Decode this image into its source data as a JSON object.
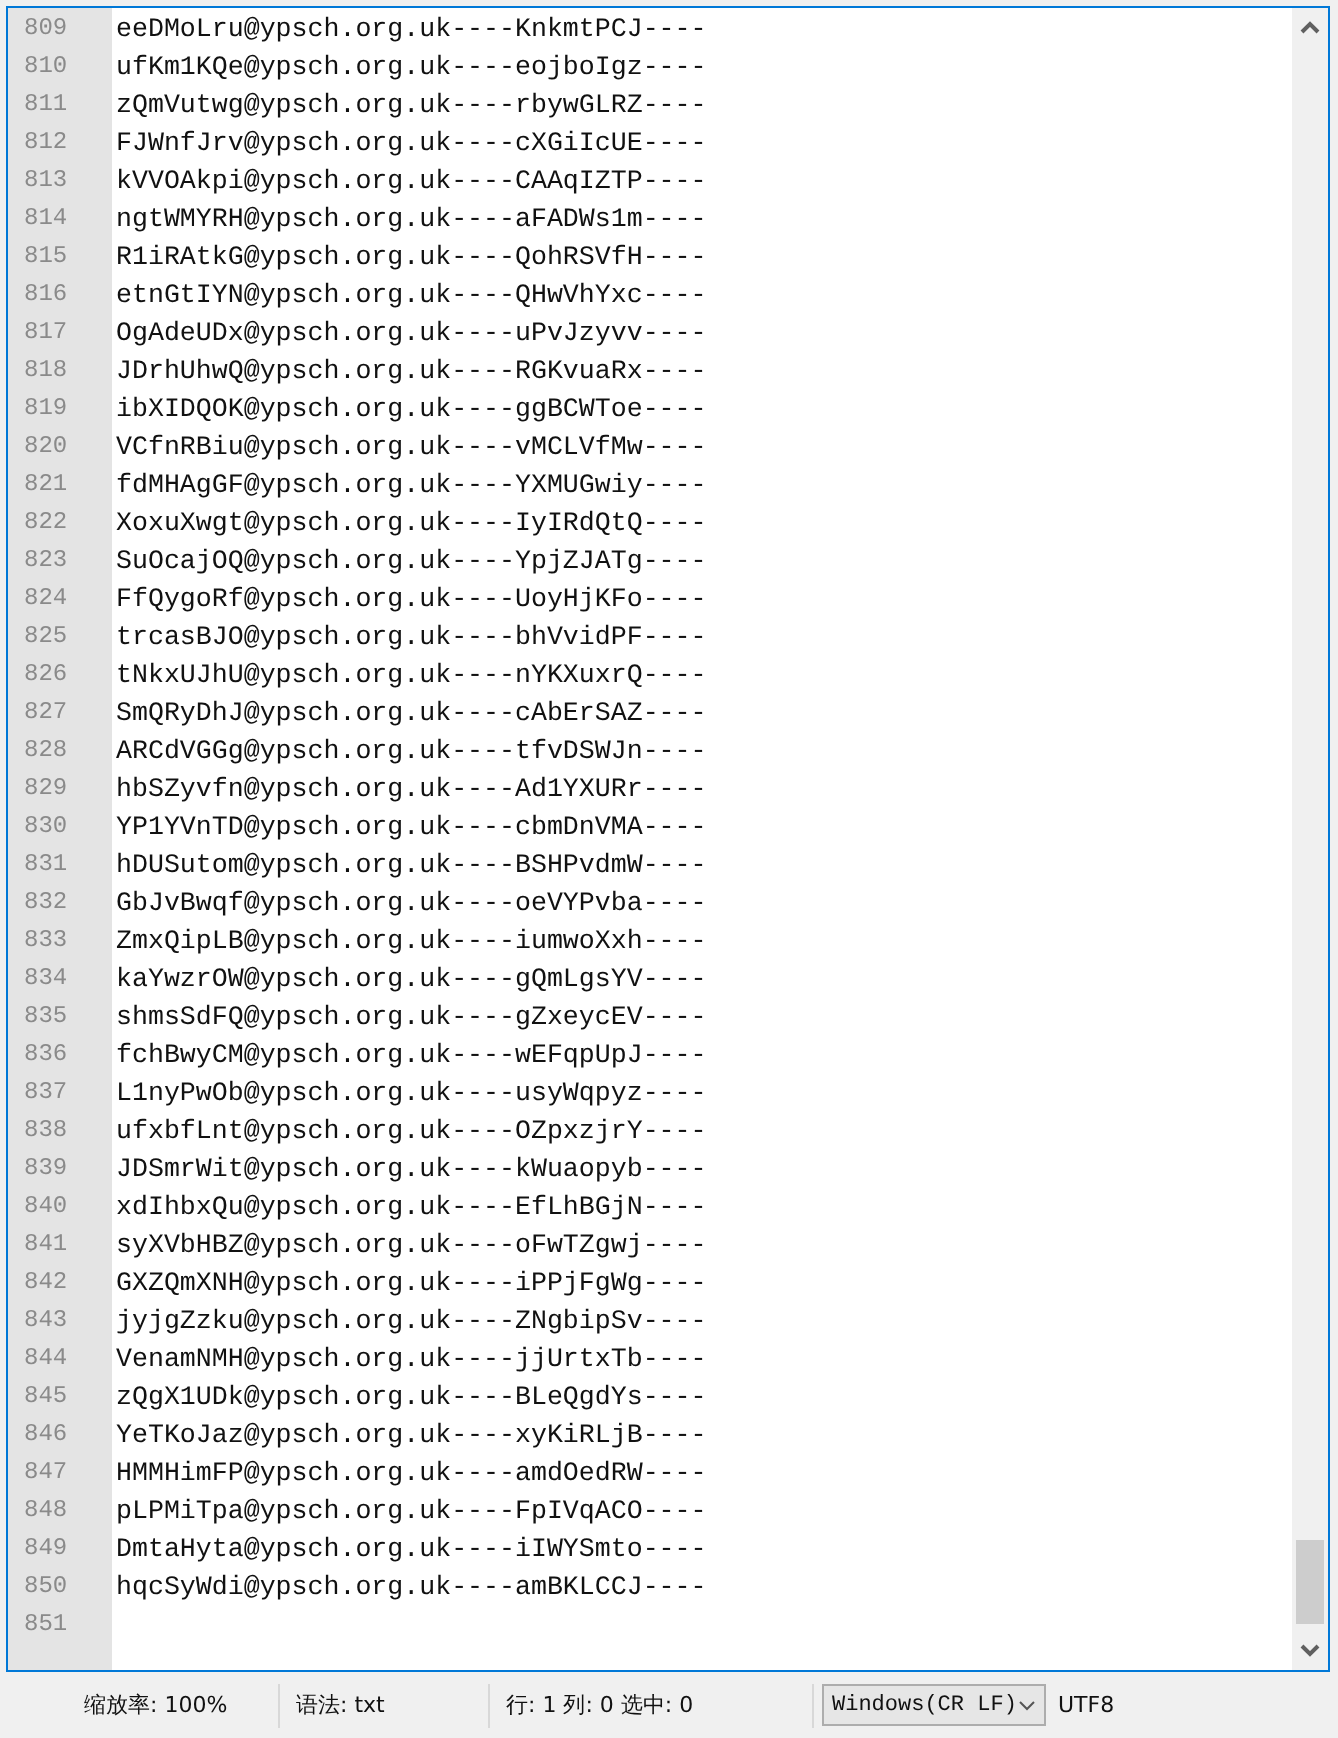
{
  "editor": {
    "lines": [
      {
        "number": "809",
        "text": "eeDMoLru@ypsch.org.uk----KnkmtPCJ----"
      },
      {
        "number": "810",
        "text": "ufKm1KQe@ypsch.org.uk----eojboIgz----"
      },
      {
        "number": "811",
        "text": "zQmVutwg@ypsch.org.uk----rbywGLRZ----"
      },
      {
        "number": "812",
        "text": "FJWnfJrv@ypsch.org.uk----cXGiIcUE----"
      },
      {
        "number": "813",
        "text": "kVVOAkpi@ypsch.org.uk----CAAqIZTP----"
      },
      {
        "number": "814",
        "text": "ngtWMYRH@ypsch.org.uk----aFADWs1m----"
      },
      {
        "number": "815",
        "text": "R1iRAtkG@ypsch.org.uk----QohRSVfH----"
      },
      {
        "number": "816",
        "text": "etnGtIYN@ypsch.org.uk----QHwVhYxc----"
      },
      {
        "number": "817",
        "text": "OgAdeUDx@ypsch.org.uk----uPvJzyvv----"
      },
      {
        "number": "818",
        "text": "JDrhUhwQ@ypsch.org.uk----RGKvuaRx----"
      },
      {
        "number": "819",
        "text": "ibXIDQOK@ypsch.org.uk----ggBCWToe----"
      },
      {
        "number": "820",
        "text": "VCfnRBiu@ypsch.org.uk----vMCLVfMw----"
      },
      {
        "number": "821",
        "text": "fdMHAgGF@ypsch.org.uk----YXMUGwiy----"
      },
      {
        "number": "822",
        "text": "XoxuXwgt@ypsch.org.uk----IyIRdQtQ----"
      },
      {
        "number": "823",
        "text": "SuOcajOQ@ypsch.org.uk----YpjZJATg----"
      },
      {
        "number": "824",
        "text": "FfQygoRf@ypsch.org.uk----UoyHjKFo----"
      },
      {
        "number": "825",
        "text": "trcasBJO@ypsch.org.uk----bhVvidPF----"
      },
      {
        "number": "826",
        "text": "tNkxUJhU@ypsch.org.uk----nYKXuxrQ----"
      },
      {
        "number": "827",
        "text": "SmQRyDhJ@ypsch.org.uk----cAbErSAZ----"
      },
      {
        "number": "828",
        "text": "ARCdVGGg@ypsch.org.uk----tfvDSWJn----"
      },
      {
        "number": "829",
        "text": "hbSZyvfn@ypsch.org.uk----Ad1YXURr----"
      },
      {
        "number": "830",
        "text": "YP1YVnTD@ypsch.org.uk----cbmDnVMA----"
      },
      {
        "number": "831",
        "text": "hDUSutom@ypsch.org.uk----BSHPvdmW----"
      },
      {
        "number": "832",
        "text": "GbJvBwqf@ypsch.org.uk----oeVYPvba----"
      },
      {
        "number": "833",
        "text": "ZmxQipLB@ypsch.org.uk----iumwoXxh----"
      },
      {
        "number": "834",
        "text": "kaYwzrOW@ypsch.org.uk----gQmLgsYV----"
      },
      {
        "number": "835",
        "text": "shmsSdFQ@ypsch.org.uk----gZxeycEV----"
      },
      {
        "number": "836",
        "text": "fchBwyCM@ypsch.org.uk----wEFqpUpJ----"
      },
      {
        "number": "837",
        "text": "L1nyPwOb@ypsch.org.uk----usyWqpyz----"
      },
      {
        "number": "838",
        "text": "ufxbfLnt@ypsch.org.uk----OZpxzjrY----"
      },
      {
        "number": "839",
        "text": "JDSmrWit@ypsch.org.uk----kWuaopyb----"
      },
      {
        "number": "840",
        "text": "xdIhbxQu@ypsch.org.uk----EfLhBGjN----"
      },
      {
        "number": "841",
        "text": "syXVbHBZ@ypsch.org.uk----oFwTZgwj----"
      },
      {
        "number": "842",
        "text": "GXZQmXNH@ypsch.org.uk----iPPjFgWg----"
      },
      {
        "number": "843",
        "text": "jyjgZzku@ypsch.org.uk----ZNgbipSv----"
      },
      {
        "number": "844",
        "text": "VenamNMH@ypsch.org.uk----jjUrtxTb----"
      },
      {
        "number": "845",
        "text": "zQgX1UDk@ypsch.org.uk----BLeQgdYs----"
      },
      {
        "number": "846",
        "text": "YeTKoJaz@ypsch.org.uk----xyKiRLjB----"
      },
      {
        "number": "847",
        "text": "HMMHimFP@ypsch.org.uk----amdOedRW----"
      },
      {
        "number": "848",
        "text": "pLPMiTpa@ypsch.org.uk----FpIVqACO----"
      },
      {
        "number": "849",
        "text": "DmtaHyta@ypsch.org.uk----iIWYSmto----"
      },
      {
        "number": "850",
        "text": "hqcSyWdi@ypsch.org.uk----amBKLCCJ----"
      },
      {
        "number": "851"
      }
    ]
  },
  "status_bar": {
    "zoom": "缩放率: 100%",
    "syntax": "语法: txt",
    "position": "行: 1 列: 0 选中: 0",
    "line_ending": "Windows(CR LF)",
    "encoding": "UTF8"
  }
}
